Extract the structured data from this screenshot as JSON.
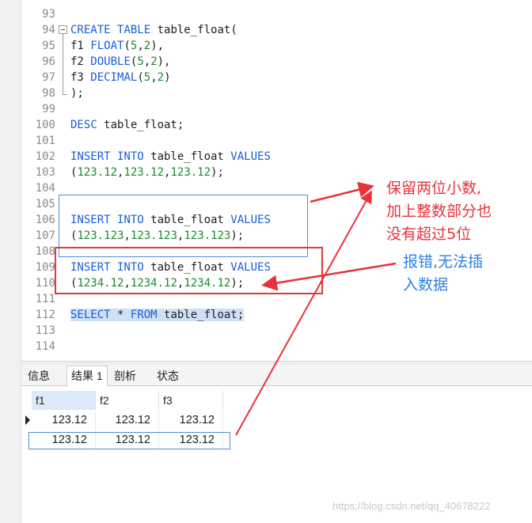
{
  "editor": {
    "line_numbers": [
      "93",
      "94",
      "95",
      "96",
      "97",
      "98",
      "99",
      "100",
      "101",
      "102",
      "103",
      "104",
      "105",
      "106",
      "107",
      "108",
      "109",
      "110",
      "111",
      "112",
      "113",
      "114"
    ],
    "code": {
      "l94_kw": "CREATE TABLE",
      "l94_rest": " table_float(",
      "l95_a": "f1 ",
      "l95_kw": "FLOAT",
      "l95_b": "(",
      "l95_n1": "5",
      "l95_c": ",",
      "l95_n2": "2",
      "l95_d": "),",
      "l96_a": "f2 ",
      "l96_kw": "DOUBLE",
      "l96_b": "(",
      "l96_n1": "5",
      "l96_c": ",",
      "l96_n2": "2",
      "l96_d": "),",
      "l97_a": "f3 ",
      "l97_kw": "DECIMAL",
      "l97_b": "(",
      "l97_n1": "5",
      "l97_c": ",",
      "l97_n2": "2",
      "l97_d": ")",
      "l98": ");",
      "l100_kw": "DESC",
      "l100_rest": " table_float;",
      "l102_kw1": "INSERT INTO",
      "l102_mid": " table_float ",
      "l102_kw2": "VALUES",
      "l103_a": "(",
      "l103_n1": "123.12",
      "l103_c1": ",",
      "l103_n2": "123.12",
      "l103_c2": ",",
      "l103_n3": "123.12",
      "l103_d": ");",
      "l106_kw1": "INSERT INTO",
      "l106_mid": " table_float ",
      "l106_kw2": "VALUES",
      "l107_a": "(",
      "l107_n1": "123.123",
      "l107_c1": ",",
      "l107_n2": "123.123",
      "l107_c2": ",",
      "l107_n3": "123.123",
      "l107_d": ");",
      "l109_kw1": "INSERT INTO",
      "l109_mid": " table_float ",
      "l109_kw2": "VALUES",
      "l110_a": "(",
      "l110_n1": "1234.12",
      "l110_c1": ",",
      "l110_n2": "1234.12",
      "l110_c2": ",",
      "l110_n3": "1234.12",
      "l110_d": ");",
      "l112_kw1": "SELECT",
      "l112_star": " * ",
      "l112_kw2": "FROM",
      "l112_rest": " table_float;"
    }
  },
  "tabs": [
    {
      "label": "信息",
      "active": false
    },
    {
      "label": "结果 1",
      "active": true
    },
    {
      "label": "剖析",
      "active": false
    },
    {
      "label": "状态",
      "active": false
    }
  ],
  "results": {
    "columns": [
      "f1",
      "f2",
      "f3"
    ],
    "rows": [
      [
        "123.12",
        "123.12",
        "123.12"
      ],
      [
        "123.12",
        "123.12",
        "123.12"
      ]
    ]
  },
  "annotations": {
    "red_note": [
      "保留两位小数,",
      "加上整数部分也",
      "没有超过5位"
    ],
    "blue_note": [
      "报错,无法插",
      "入数据"
    ]
  },
  "watermark": "https://blog.csdn.net/qq_40678222",
  "colors": {
    "keyword": "#1a5cd9",
    "number": "#1a8a2a",
    "annotation_red": "#e8323a",
    "annotation_blue": "#2f7fe0",
    "selection": "#cfe0f4"
  }
}
